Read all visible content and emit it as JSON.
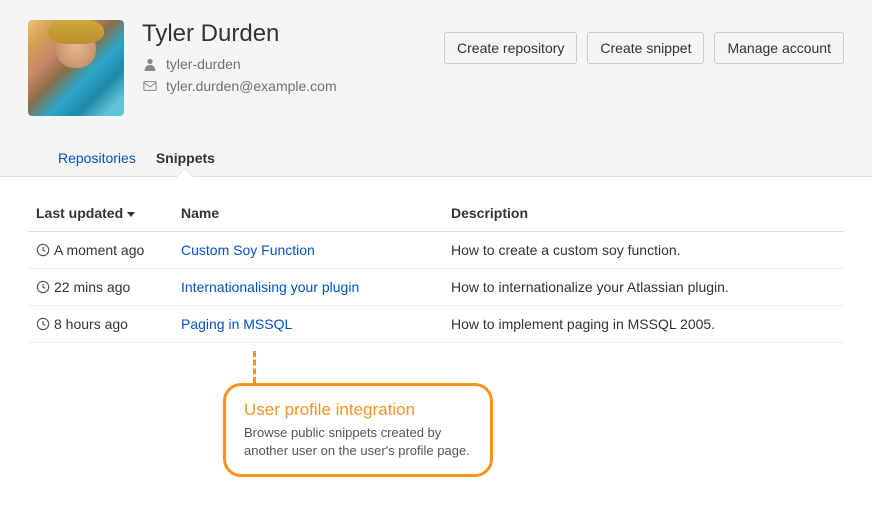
{
  "profile": {
    "name": "Tyler Durden",
    "username": "tyler-durden",
    "email": "tyler.durden@example.com"
  },
  "actions": {
    "create_repo": "Create repository",
    "create_snippet": "Create snippet",
    "manage_account": "Manage account"
  },
  "tabs": {
    "repositories": "Repositories",
    "snippets": "Snippets"
  },
  "table": {
    "headers": {
      "updated": "Last updated",
      "name": "Name",
      "description": "Description"
    },
    "rows": [
      {
        "updated": "A moment ago",
        "name": "Custom Soy Function",
        "description": "How to create a custom soy function."
      },
      {
        "updated": "22 mins ago",
        "name": "Internationalising your plugin",
        "description": "How to internationalize your Atlassian plugin."
      },
      {
        "updated": "8 hours ago",
        "name": "Paging in MSSQL",
        "description": "How to implement paging in MSSQL 2005."
      }
    ]
  },
  "callout": {
    "title": "User profile integration",
    "text": "Browse public snippets created by another user on the user's profile page."
  }
}
